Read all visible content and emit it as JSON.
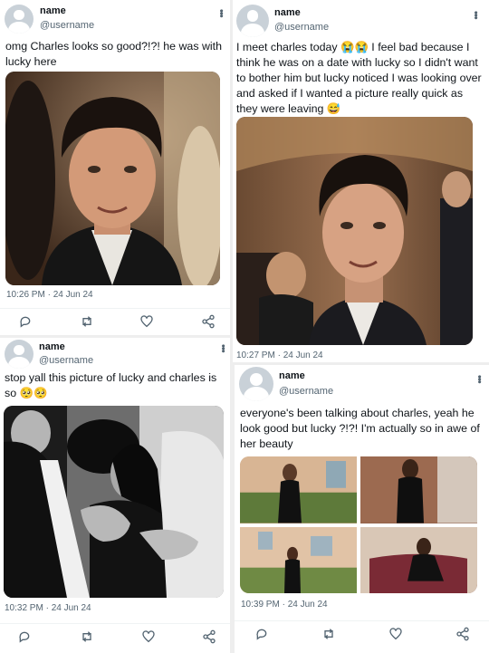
{
  "posts": [
    {
      "name": "name",
      "username": "@username",
      "text": "omg Charles looks so good?!?! he was with lucky here",
      "timestamp": "10:26 PM · 24 Jun 24",
      "media_alt": "photo of a dark-haired man in a tuxedo at an event"
    },
    {
      "name": "name",
      "username": "@username",
      "text": "I meet charles today 😭😭 I feel bad because I think he was on a date with lucky so I didn't want to bother him but lucky noticed I was looking over and asked if I wanted a picture really quick as they were leaving 😅",
      "timestamp": "10:27 PM · 24 Jun 24",
      "media_alt": "selfie of a smiling dark-haired man in a dark jacket"
    },
    {
      "name": "name",
      "username": "@username",
      "text": "stop yall this picture of lucky and charles is so 🥺🥺",
      "timestamp": "10:32 PM · 24 Jun 24",
      "media_alt": "black and white photo of a couple embracing at a party"
    },
    {
      "name": "name",
      "username": "@username",
      "text": "everyone's been talking about charles, yeah he look good but lucky ?!?! I'm actually so in awe of her beauty",
      "timestamp": "10:39 PM · 24 Jun 24",
      "media_alt": "four photos of a woman in a black lace dress"
    }
  ],
  "icons": [
    "reply-icon",
    "retweet-icon",
    "like-icon",
    "share-icon",
    "more-icon",
    "default-avatar-icon"
  ],
  "colors": {
    "text": "#0f1419",
    "secondary": "#536471",
    "background": "#ffffff"
  }
}
